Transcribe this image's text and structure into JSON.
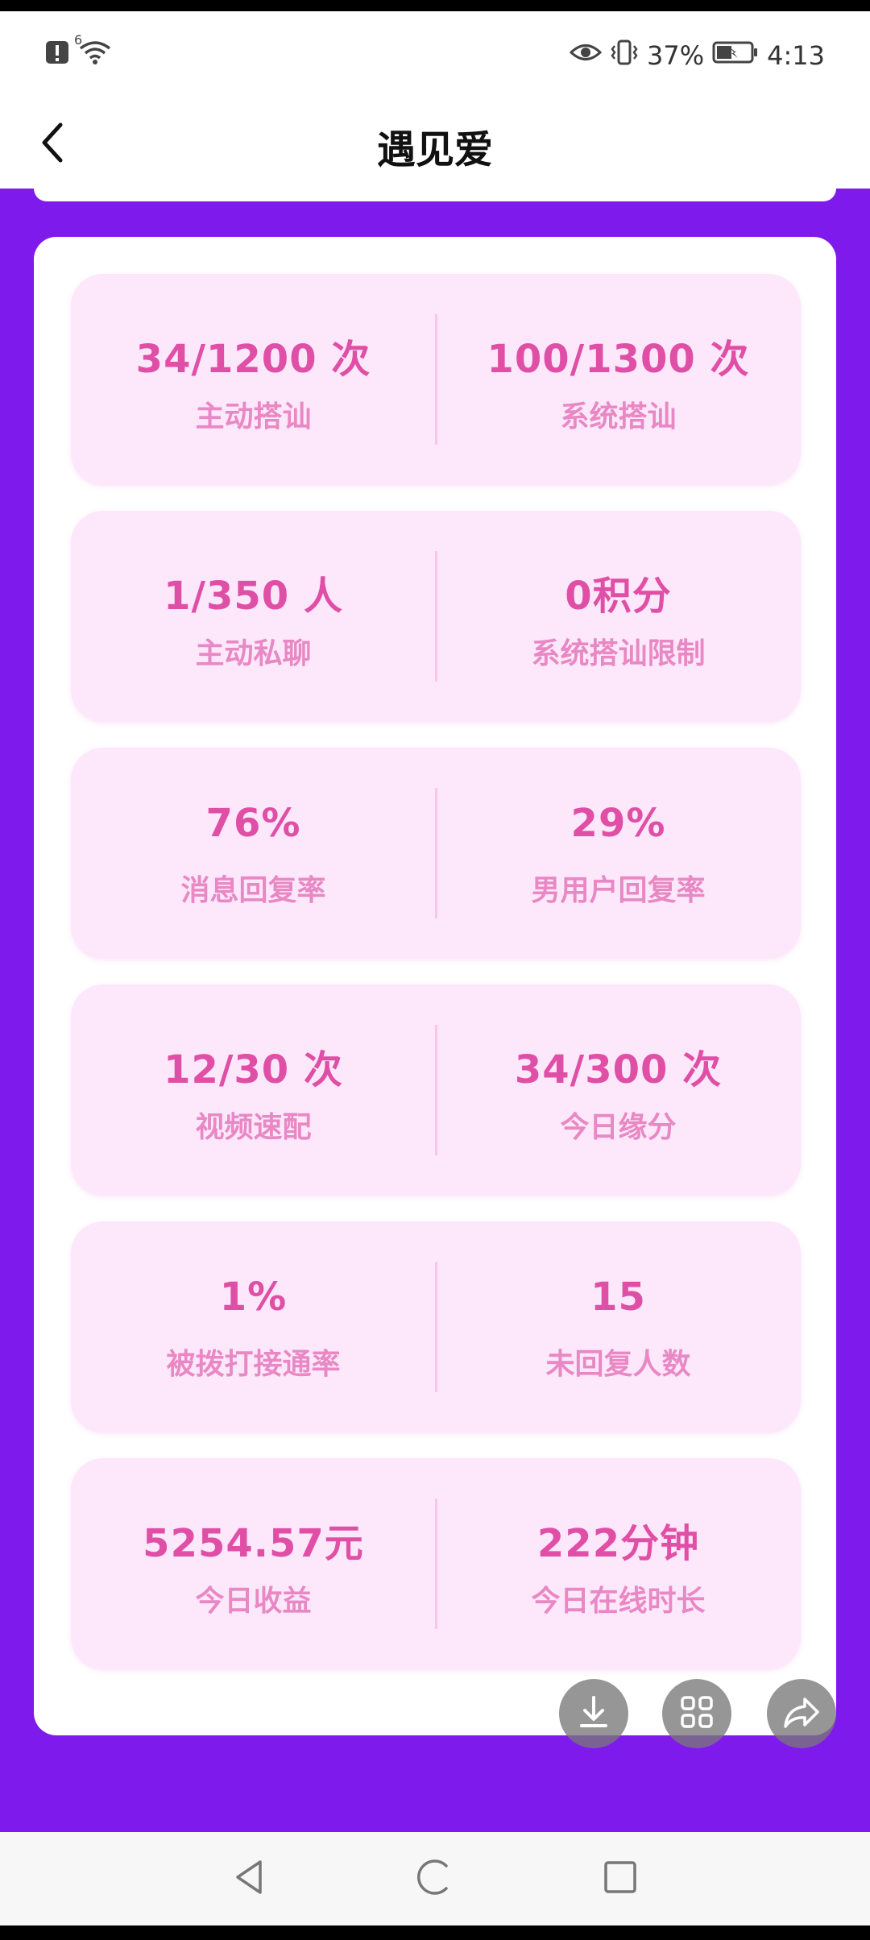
{
  "status_bar": {
    "signal_label": "6",
    "battery": "37%",
    "time": "4:13",
    "icons": [
      "alert-icon",
      "wifi-icon",
      "eye-icon",
      "vibrate-icon",
      "battery-icon"
    ]
  },
  "header": {
    "title": "遇见爱",
    "back_icon": "chevron-left-icon"
  },
  "stats": [
    {
      "left": {
        "value": "34/1200 次",
        "label": "主动搭讪"
      },
      "right": {
        "value": "100/1300 次",
        "label": "系统搭讪"
      }
    },
    {
      "left": {
        "value": "1/350 人",
        "label": "主动私聊"
      },
      "right": {
        "value": "0积分",
        "label": "系统搭讪限制"
      }
    },
    {
      "left": {
        "value": "76%",
        "label": "消息回复率"
      },
      "right": {
        "value": "29%",
        "label": "男用户回复率"
      }
    },
    {
      "left": {
        "value": "12/30 次",
        "label": "视频速配"
      },
      "right": {
        "value": "34/300 次",
        "label": "今日缘分"
      }
    },
    {
      "left": {
        "value": "1%",
        "label": "被拨打接通率"
      },
      "right": {
        "value": "15",
        "label": "未回复人数"
      }
    },
    {
      "left": {
        "value": "5254.57元",
        "label": "今日收益"
      },
      "right": {
        "value": "222分钟",
        "label": "今日在线时长"
      }
    }
  ],
  "floating_actions": [
    "download-icon",
    "grid-icon",
    "share-icon"
  ],
  "nav_bar": [
    "nav-back-icon",
    "nav-home-icon",
    "nav-recent-icon"
  ],
  "colors": {
    "background_purple": "#7f1aec",
    "card_pink": "#fde8fb",
    "value_pink": "#e04fa6",
    "label_pink": "#e888c4"
  }
}
